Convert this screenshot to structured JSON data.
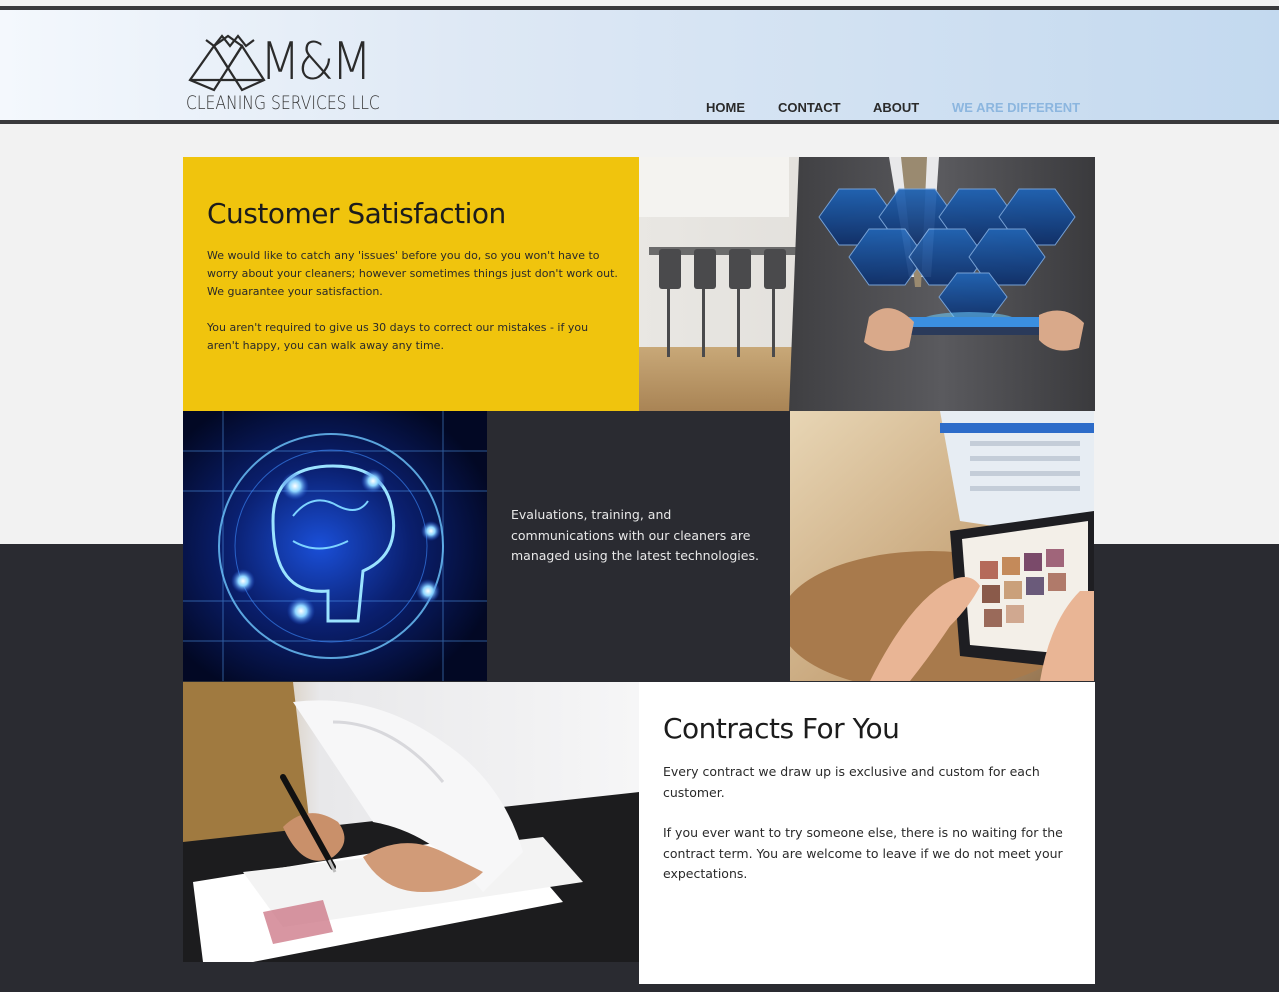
{
  "header": {
    "logo": {
      "name": "M&M",
      "tagline": "CLEANING SERVICES LLC"
    },
    "nav": [
      {
        "label": "HOME",
        "active": false
      },
      {
        "label": "CONTACT",
        "active": false
      },
      {
        "label": "ABOUT",
        "active": false
      },
      {
        "label": "WE ARE DIFFERENT",
        "active": true
      }
    ]
  },
  "sections": {
    "satisfaction": {
      "title": "Customer Satisfaction",
      "line1": "We would like to catch any 'issues' before you do, so you won't have to worry about your cleaners; however sometimes things just don't work out.",
      "line2": "We guarantee your satisfaction.",
      "line3": "You aren't required to give us 30 days to correct our mistakes - if you aren't happy, you can walk away any time."
    },
    "technology": {
      "text": "Evaluations, training, and communications with our cleaners are managed using the latest technologies."
    },
    "contracts": {
      "title": "Contracts For You",
      "para1": "Every contract we draw up is exclusive and custom for each customer.",
      "para2": "If you ever want to try someone else, there is no waiting for the contract term. You are welcome to leave if we do not meet your expectations."
    }
  },
  "colors": {
    "accent_yellow": "#f0c40d",
    "dark": "#2a2b31",
    "nav_active": "#8cb6df"
  }
}
